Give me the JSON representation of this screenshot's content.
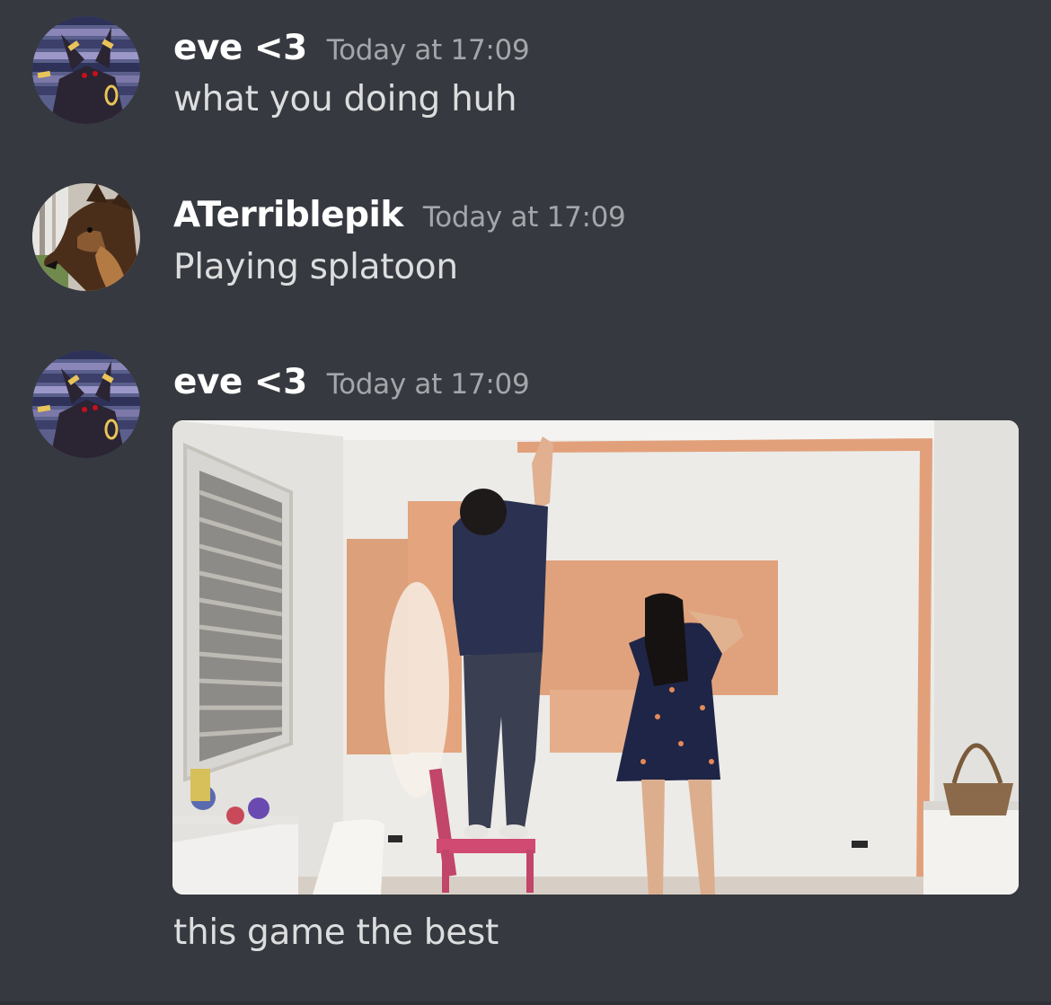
{
  "messages": [
    {
      "author": "eve <3",
      "timestamp": "Today at 17:09",
      "text": "what you doing huh",
      "avatar_icon": "umbreon-avatar"
    },
    {
      "author": "ATerriblepik",
      "timestamp": "Today at 17:09",
      "text": "Playing splatoon",
      "avatar_icon": "german-shepherd-avatar"
    },
    {
      "author": "eve <3",
      "timestamp": "Today at 17:09",
      "attachment": "gif-two-women-painting-wall-orange",
      "text": "this game the best",
      "avatar_icon": "umbreon-avatar"
    }
  ],
  "colors": {
    "background": "#36393f",
    "username": "#ffffff",
    "timestamp": "#a3a6aa",
    "message_text": "#dcddde",
    "paint": "#e0a37f"
  }
}
